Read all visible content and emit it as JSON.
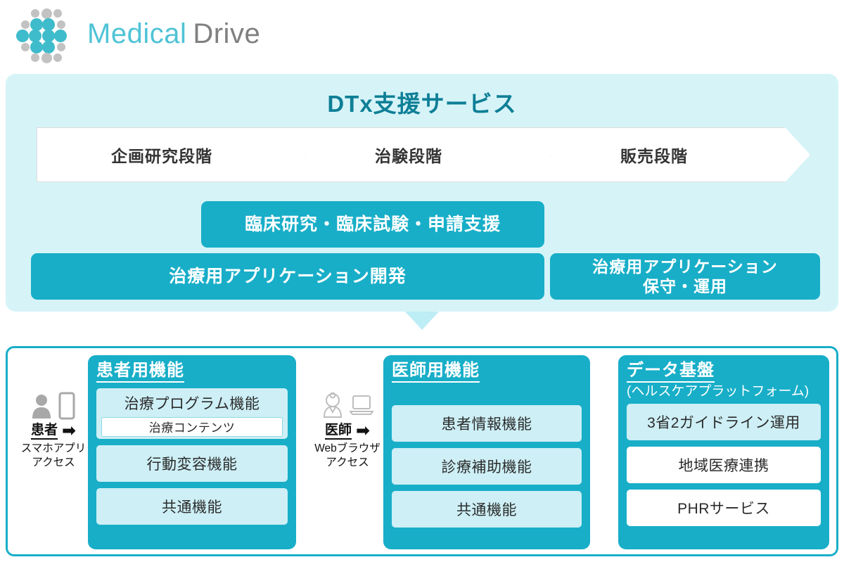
{
  "logo": {
    "brand_primary": "Medical",
    "brand_secondary": "Drive",
    "color_primary": "#4FC3D6",
    "color_secondary": "#808080"
  },
  "service_band": {
    "title": "DTx支援サービス",
    "background": "#D6F4F8",
    "title_color": "#0E7F96",
    "stages": [
      {
        "label": "企画研究段階"
      },
      {
        "label": "治験段階"
      },
      {
        "label": "販売段階"
      }
    ],
    "service_boxes": [
      {
        "id": "support",
        "label": "臨床研究・臨床試験・申請支援"
      },
      {
        "id": "development",
        "label": "治療用アプリケーション開発"
      },
      {
        "id": "maintenance",
        "label": "治療用アプリケーション\n保守・運用"
      }
    ],
    "accent_color": "#18AEC8"
  },
  "platform": {
    "border_color": "#18AEC8",
    "actors": [
      {
        "id": "patient",
        "role": "患者",
        "arrow": "➡",
        "access": "スマホアプリ\nアクセス",
        "icons": [
          "person-icon",
          "smartphone-icon"
        ]
      },
      {
        "id": "doctor",
        "role": "医師",
        "arrow": "➡",
        "access": "Webブラウザ\nアクセス",
        "icons": [
          "doctor-icon",
          "laptop-icon"
        ]
      }
    ],
    "groups": [
      {
        "id": "patient-functions",
        "title": "患者用機能",
        "subtitle": "",
        "items": [
          {
            "label": "治療プログラム機能",
            "nested": "治療コンテンツ",
            "style": "tinted"
          },
          {
            "label": "行動変容機能",
            "style": "tinted"
          },
          {
            "label": "共通機能",
            "style": "tinted"
          }
        ]
      },
      {
        "id": "doctor-functions",
        "title": "医師用機能",
        "subtitle": "",
        "items": [
          {
            "label": "患者情報機能",
            "style": "tinted"
          },
          {
            "label": "診療補助機能",
            "style": "tinted"
          },
          {
            "label": "共通機能",
            "style": "tinted"
          }
        ]
      },
      {
        "id": "data-platform",
        "title": "データ基盤",
        "subtitle": "(ヘルスケアプラットフォーム)",
        "items": [
          {
            "label": "3省2ガイドライン運用",
            "style": "tinted"
          },
          {
            "label": "地域医療連携",
            "style": "white"
          },
          {
            "label": "PHRサービス",
            "style": "white"
          }
        ]
      }
    ]
  }
}
